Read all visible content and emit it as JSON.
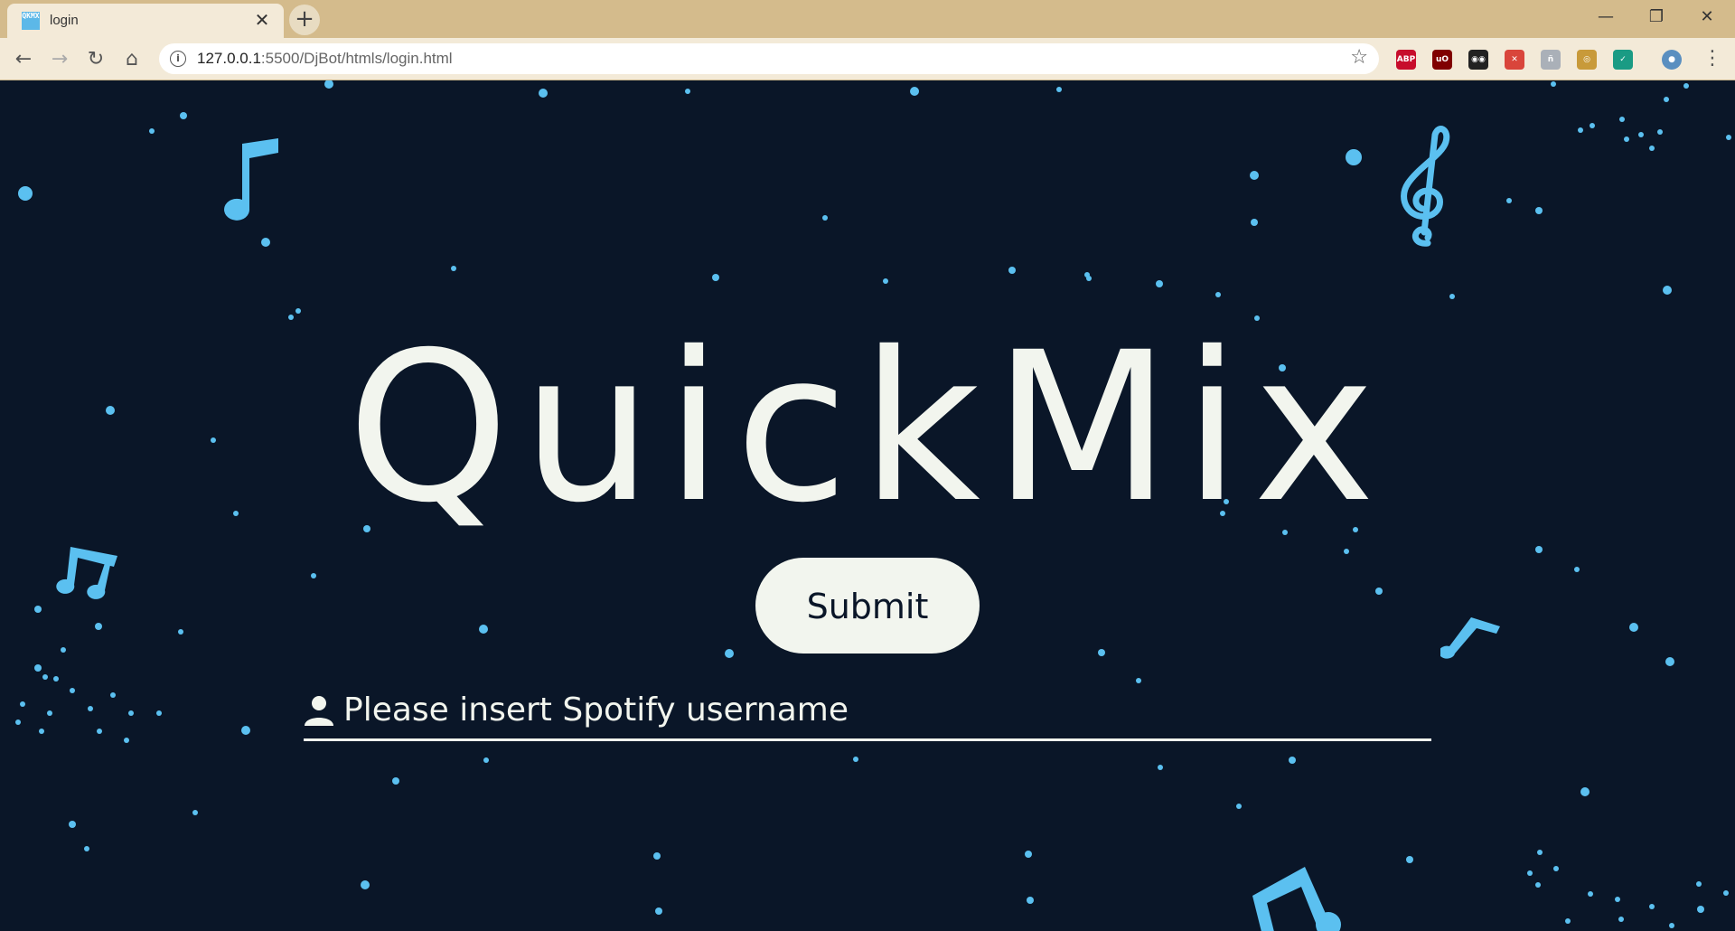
{
  "browser": {
    "tab": {
      "favicon_text": "QKMX",
      "title": "login",
      "close": "✕"
    },
    "new_tab": "+",
    "window_controls": {
      "minimize": "—",
      "restore": "❐",
      "close": "✕"
    },
    "nav": {
      "back": "←",
      "forward": "→",
      "reload": "↻",
      "home": "⌂"
    },
    "address": {
      "host": "127.0.0.1",
      "rest": ":5500/DjBot/htmls/login.html"
    },
    "bookmark_star": "☆",
    "extensions": [
      {
        "name": "adblock-plus-icon",
        "label": "ABP",
        "color": "#c70d2c"
      },
      {
        "name": "ublock-icon",
        "label": "uO",
        "color": "#800000"
      },
      {
        "name": "incognito-ext-icon",
        "label": "◉◉",
        "color": "#222222"
      },
      {
        "name": "red-circle-ext-icon",
        "label": "✕",
        "color": "#d9453b"
      },
      {
        "name": "gray-ext-icon",
        "label": "ñ",
        "color": "#aab0b8"
      },
      {
        "name": "owl-ext-icon",
        "label": "◎",
        "color": "#c89a3a"
      },
      {
        "name": "green-check-ext-icon",
        "label": "✓",
        "color": "#1a9b84"
      },
      {
        "name": "profile-avatar-icon",
        "label": "●",
        "color": "#5a8fc0"
      }
    ],
    "menu": "⋮"
  },
  "page": {
    "logo": "QuickMix",
    "submit_label": "Submit",
    "username_placeholder": "Please insert Spotify username",
    "colors": {
      "background": "#0a1628",
      "accent": "#5bc0f0",
      "text": "#f2f5ee"
    }
  }
}
